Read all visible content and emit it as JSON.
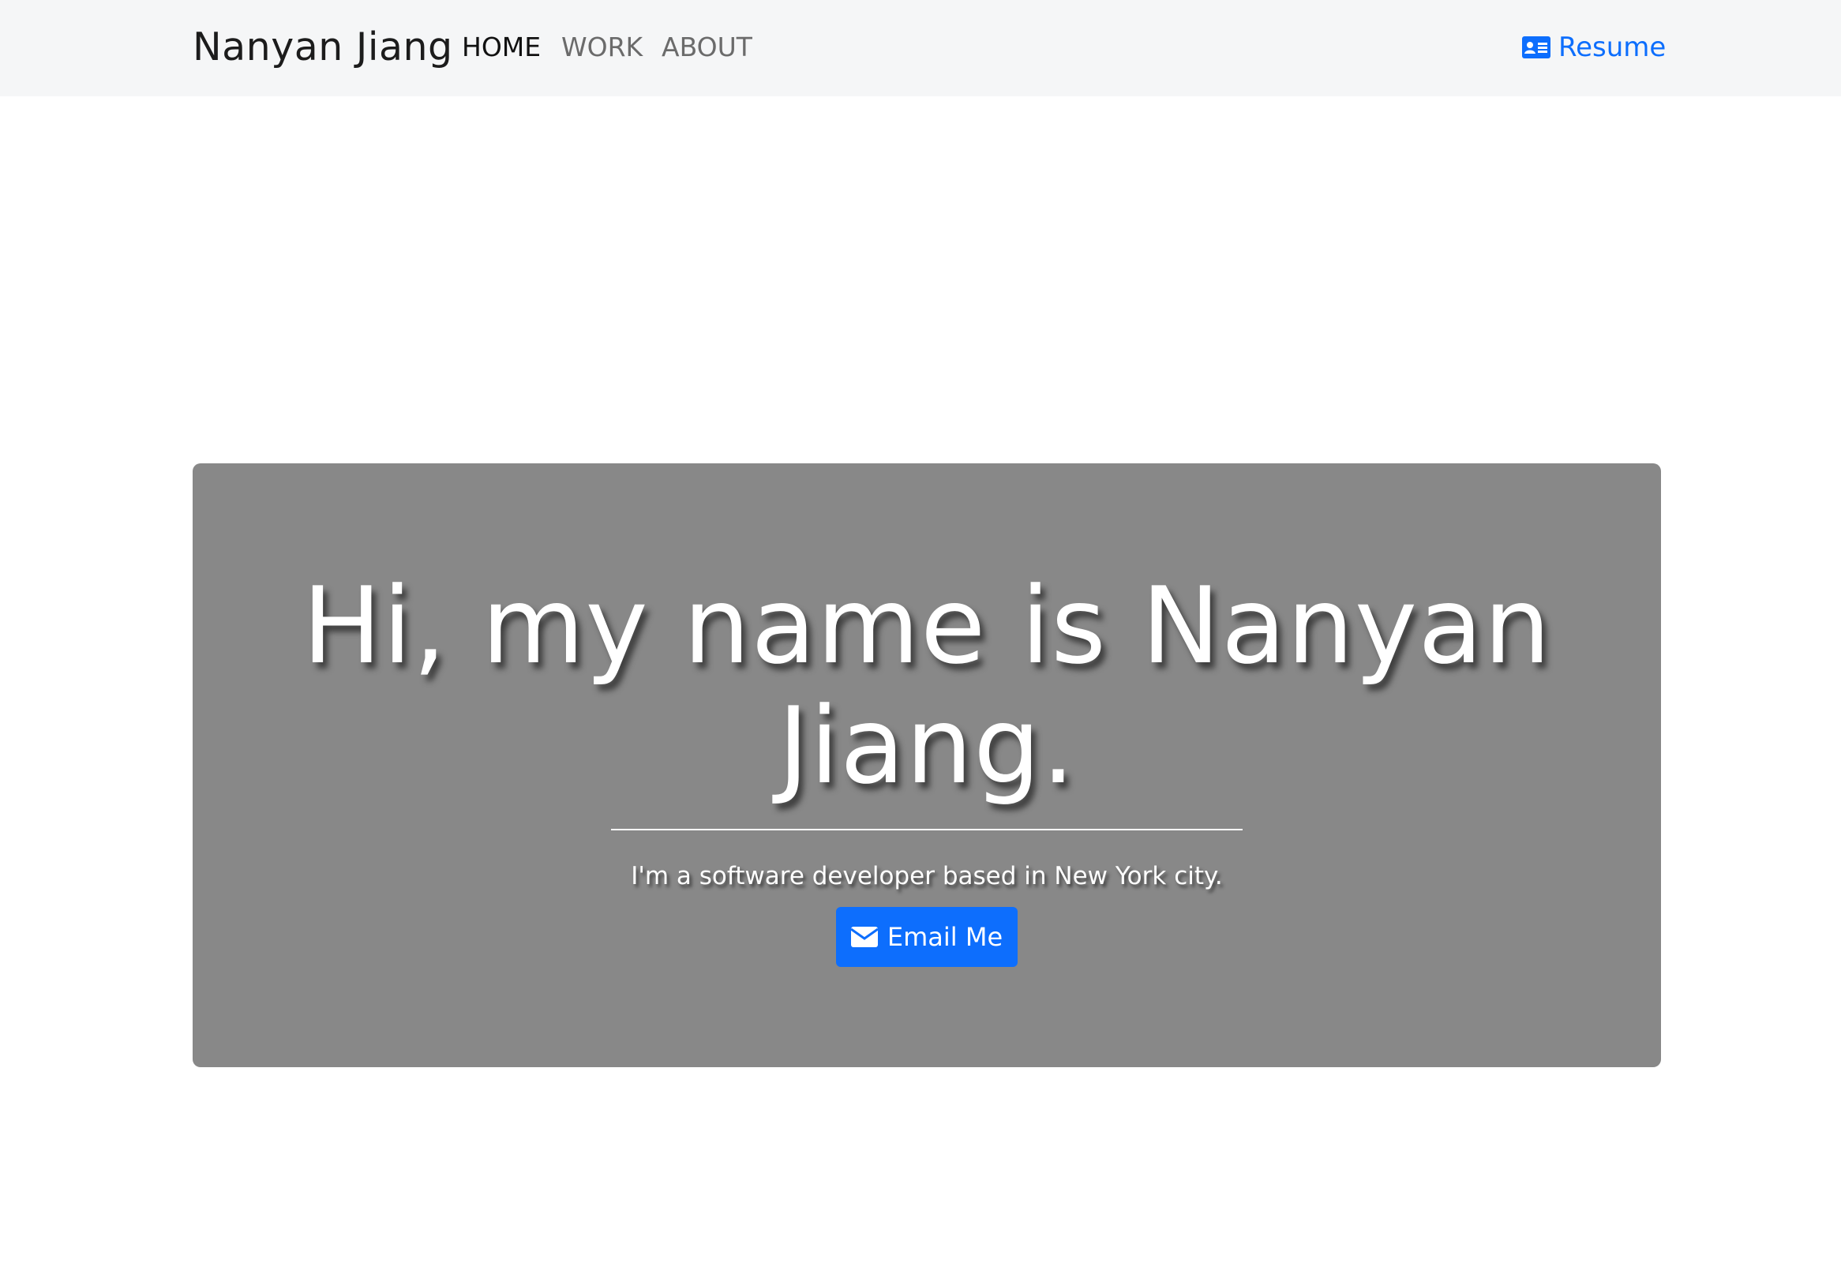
{
  "navbar": {
    "brand": "Nanyan Jiang",
    "links": [
      {
        "label": "HOME",
        "active": true
      },
      {
        "label": "WORK",
        "active": false
      },
      {
        "label": "ABOUT",
        "active": false
      }
    ],
    "resume": {
      "label": "Resume",
      "icon": "id-card-icon"
    }
  },
  "hero": {
    "title": "Hi, my name is Nanyan Jiang.",
    "subtitle": "I'm a software developer based in New York city.",
    "email_button": {
      "label": "Email Me",
      "icon": "envelope-icon"
    }
  },
  "colors": {
    "accent": "#0d6efd",
    "navbar_bg": "#f5f6f7",
    "hero_bg": "#888888"
  }
}
